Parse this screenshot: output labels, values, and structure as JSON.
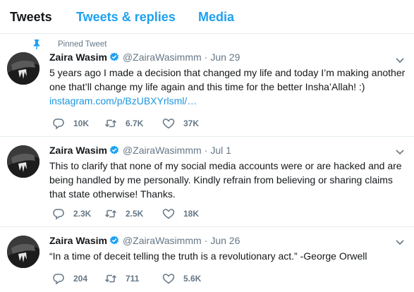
{
  "tabs": [
    {
      "label": "Tweets"
    },
    {
      "label": "Tweets & replies"
    },
    {
      "label": "Media"
    }
  ],
  "colors": {
    "accent": "#1da1f2",
    "text": "#14171a",
    "muted": "#657786",
    "link": "#1b95e0",
    "divider": "#e6ecf0"
  },
  "tweets": [
    {
      "pinned_label": "Pinned Tweet",
      "name": "Zaira Wasim",
      "handle": "@ZairaWasimmm",
      "separator": "·",
      "date": "Jun 29",
      "text": "5 years ago I made a decision that changed my life and today I’m making another one that’ll change my life again and this time for the better Insha’Allah! :)",
      "link": "instagram.com/p/BzUBXYrlsml/…",
      "replies": "10K",
      "retweets": "6.7K",
      "likes": "37K"
    },
    {
      "name": "Zaira Wasim",
      "handle": "@ZairaWasimmm",
      "separator": "·",
      "date": "Jul 1",
      "text": "This to clarify that none of my social media accounts were or are hacked and are being handled by me personally. Kindly refrain from believing or sharing claims that state otherwise! Thanks.",
      "replies": "2.3K",
      "retweets": "2.5K",
      "likes": "18K"
    },
    {
      "name": "Zaira Wasim",
      "handle": "@ZairaWasimmm",
      "separator": "·",
      "date": "Jun 26",
      "text": "“In a time of deceit telling the truth is a revolutionary act.” -George Orwell",
      "replies": "204",
      "retweets": "711",
      "likes": "5.6K"
    }
  ]
}
